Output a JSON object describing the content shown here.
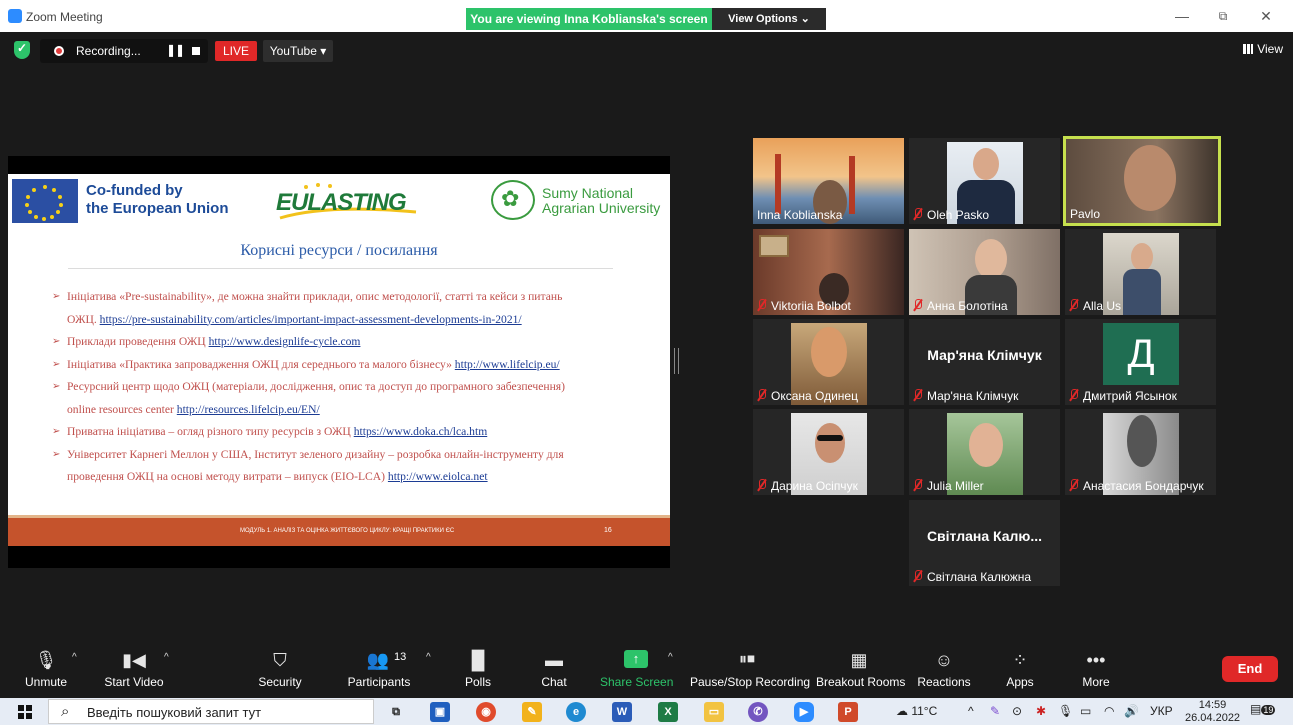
{
  "window": {
    "title": "Zoom Meeting",
    "banner": "You are viewing Inna Koblianska's screen",
    "view_options": "View Options ⌄",
    "minimize": "—",
    "restore": "⧉",
    "close": "✕"
  },
  "topbar": {
    "recording_label": "Recording...",
    "pause_icon": "❚❚",
    "live_label": "LIVE",
    "youtube_label": "YouTube ▾",
    "view_label": "View"
  },
  "slide": {
    "cofunded_line1": "Co-funded by",
    "cofunded_line2": "the European Union",
    "eulasting": "EULASTING",
    "sumy_line1": "Sumy National",
    "sumy_line2": "Agrarian University",
    "title": "Корисні ресурси / посилання",
    "bullets": [
      {
        "text": "Ініціатива «Pre-sustainability», де можна знайти приклади, опис методології, статті та кейси з питань",
        "cont": "ОЖЦ. ",
        "link": "https://pre-sustainability.com/articles/important-impact-assessment-developments-in-2021/"
      },
      {
        "text": "Приклади проведення ОЖЦ ",
        "link": "http://www.designlife-cycle.com"
      },
      {
        "text": "Ініціатива «Практика запровадження ОЖЦ для середнього та малого бізнесу» ",
        "link": "http://www.lifelcip.eu/"
      },
      {
        "text": "Ресурсний центр щодо ОЖЦ (матеріали, дослідження, опис та доступ до програмного забезпечення)",
        "cont": "online resources center ",
        "link": "http://resources.lifelcip.eu/EN/"
      },
      {
        "text": "Приватна ініціатива – огляд різного типу ресурсів з ОЖЦ ",
        "link": "https://www.doka.ch/lca.htm"
      },
      {
        "text": "Університет Карнегі Меллон у США, Інститут зеленого дизайну – розробка онлайн-інструменту для",
        "cont": "проведення ОЖЦ на основі методу витрати – випуск (EIO-LCA) ",
        "link": "http://www.eiolca.net"
      }
    ],
    "footer_text": "МОДУЛЬ 1. АНАЛІЗ ТА ОЦІНКА ЖИТТЄВОГО ЦИКЛУ: КРАЩІ ПРАКТИКИ ЄС",
    "page_number": "16"
  },
  "participants": [
    {
      "name": "Inna Koblianska",
      "muted": false
    },
    {
      "name": "Oleh Pasko",
      "muted": true
    },
    {
      "name": "Pavlo",
      "muted": false
    },
    {
      "name": "Viktoriia Bolbot",
      "muted": true
    },
    {
      "name": "Анна Болотіна",
      "muted": true
    },
    {
      "name": "Alla Us",
      "muted": true
    },
    {
      "name": "Оксана Одинец",
      "muted": true
    },
    {
      "name": "Мар'яна Клімчук",
      "display": "Мар'яна Клімчук",
      "muted": true
    },
    {
      "name": "Дмитрий Ясынок",
      "initial": "Д",
      "muted": true
    },
    {
      "name": "Дарина Осіпчук",
      "muted": true
    },
    {
      "name": "Julia Miller",
      "muted": true
    },
    {
      "name": "Анастасия Бондарчук",
      "muted": true
    },
    {
      "name": "Світлана Калюжна",
      "display": "Світлана Калю...",
      "muted": true
    }
  ],
  "toolbar": {
    "unmute": "Unmute",
    "start_video": "Start Video",
    "security": "Security",
    "participants": "Participants",
    "participants_count": "13",
    "polls": "Polls",
    "chat": "Chat",
    "share_screen": "Share Screen",
    "pause_recording": "Pause/Stop Recording",
    "breakout_rooms": "Breakout Rooms",
    "reactions": "Reactions",
    "apps": "Apps",
    "more": "More",
    "end": "End"
  },
  "taskbar": {
    "search_placeholder": "Введіть пошуковий запит тут",
    "weather": "11°C",
    "language": "УКР",
    "time": "14:59",
    "date": "26.04.2022",
    "notifications": "19"
  },
  "colors": {
    "accent_green": "#2dc36a",
    "live_red": "#e02828",
    "end_red": "#e02828",
    "active_speaker": "#c6e04e",
    "slide_footer": "#c5532c"
  }
}
